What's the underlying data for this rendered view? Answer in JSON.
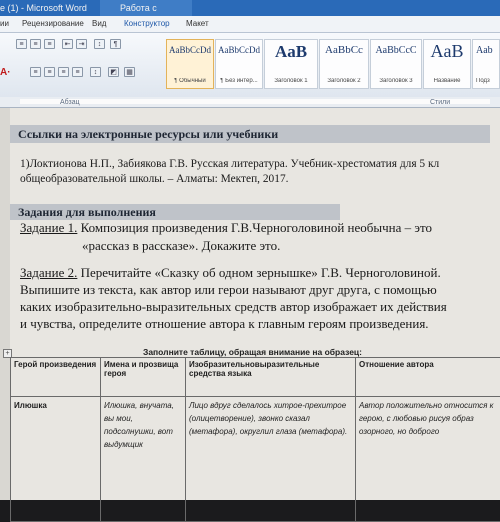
{
  "window": {
    "title": "e (1) - Microsoft Word",
    "context_tab_group": "Работа с таблицами"
  },
  "ribbon_tabs": [
    "ии",
    "Рецензирование",
    "Вид",
    "Конструктор",
    "Макет"
  ],
  "active_tab": "Конструктор",
  "ribbon": {
    "paragraph_group": "Абзац",
    "styles_group": "Стили",
    "styles": [
      {
        "preview": "AaBbCcDd",
        "name": "¶ Обычный"
      },
      {
        "preview": "AaBbCcDd",
        "name": "¶ Без интер..."
      },
      {
        "preview": "AaB",
        "name": "Заголовок 1"
      },
      {
        "preview": "AaBbCc",
        "name": "Заголовок 2"
      },
      {
        "preview": "AaBbCcC",
        "name": "Заголовок 3"
      },
      {
        "preview": "AaB",
        "name": "Название"
      },
      {
        "preview": "Aab",
        "name": "Подз"
      }
    ]
  },
  "document": {
    "sources_heading": "Ссылки на электронные ресурсы или учебники",
    "reference_line1": "1)Локтионова Н.П., Забиякова Г.В. Русская литература. Учебник-хрестоматия для 5 кл",
    "reference_line2": "общеобразовательной школы. – Алматы: Мектеп, 2017.",
    "tasks_heading": "Задания для выполнения",
    "task1_label": "Задание 1.",
    "task1_line1": " Композиция произведения Г.В.Черноголовиной необычна – это",
    "task1_line2": "«рассказ в рассказе». Докажите это.",
    "task2_label": "Задание 2.",
    "task2_line1": " Перечитайте «Сказку об одном зернышке» Г.В. Черноголовиной.",
    "task2_line2": "Выпишите из текста, как автор или герои называют друг друга, с помощью",
    "task2_line3": "каких изобразительно-выразительных средств автор изображает их действия",
    "task2_line4": "и чувства, определите отношение автора к главным героям произведения.",
    "table_caption": "Заполните таблицу, обращая внимание на образец:",
    "table": {
      "headers": [
        "Герой произведения",
        "Имена и прозвища героя",
        "Изобразительновыразительные средства языка",
        "Отношение автора"
      ],
      "row": {
        "hero": "Илюшка",
        "names": "Илюшка, внучата, вы мои, подсолнушки, вот выдумщик",
        "means": "Лицо вдруг сделалось хитрое-прехитрое (олицетворение), звонко сказал (метафора), округлил глаза (метафора).",
        "attitude": "Автор положительно относится к герою, с любовью рисуя образ озорного, но доброго"
      }
    }
  }
}
